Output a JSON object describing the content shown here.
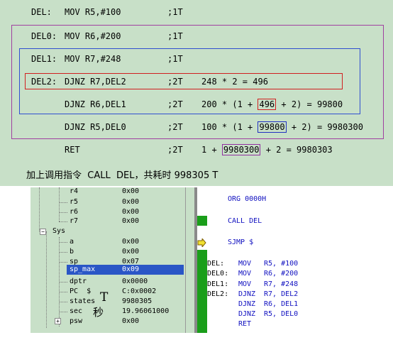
{
  "code": {
    "lines": [
      {
        "label": "DEL:",
        "instr": "MOV R5,#100",
        "cycles": ";1T",
        "pre": "",
        "box": "",
        "post": ""
      },
      {
        "label": "DEL0:",
        "instr": "MOV R6,#200",
        "cycles": ";1T",
        "pre": "",
        "box": "",
        "post": ""
      },
      {
        "label": "DEL1:",
        "instr": "MOV R7,#248",
        "cycles": ";1T",
        "pre": "",
        "box": "",
        "post": ""
      },
      {
        "label": "DEL2:",
        "instr": "DJNZ R7,DEL2",
        "cycles": ";2T",
        "pre": "248 * 2 = 496",
        "box": "",
        "post": ""
      },
      {
        "label": "",
        "instr": "DJNZ R6,DEL1",
        "cycles": ";2T",
        "pre": "200 * (1 + ",
        "box": "496",
        "post": " + 2) = 99800"
      },
      {
        "label": "",
        "instr": "DJNZ R5,DEL0",
        "cycles": ";2T",
        "pre": "100 * (1 + ",
        "box": "99800",
        "post": " + 2) = 9980300"
      },
      {
        "label": "",
        "instr": "RET",
        "cycles": ";2T",
        "pre": "1 + ",
        "box": "9980300",
        "post": " + 2 = 9980303"
      }
    ],
    "summary": "加上调用指令  CALL  DEL，共耗时 998305 T",
    "colors": {
      "outer_box": "#a040a0",
      "inner_box": "#3050d0",
      "highlight": "#d02020",
      "value_box_1": "#d02020",
      "value_box_2": "#2030c0",
      "value_box_3": "#9030a0"
    }
  },
  "registers": {
    "rows": [
      {
        "name": "r4",
        "value": "0x00"
      },
      {
        "name": "r5",
        "value": "0x00"
      },
      {
        "name": "r6",
        "value": "0x00"
      },
      {
        "name": "r7",
        "value": "0x00"
      },
      {
        "name": "Sys",
        "value": ""
      },
      {
        "name": "a",
        "value": "0x00"
      },
      {
        "name": "b",
        "value": "0x00"
      },
      {
        "name": "sp",
        "value": "0x07"
      },
      {
        "name": "sp_max",
        "value": "0x09"
      },
      {
        "name": "dptr",
        "value": "0x0000"
      },
      {
        "name": "PC  $",
        "value": "C:0x0002"
      },
      {
        "name": "states",
        "value": "9980305"
      },
      {
        "name": "sec",
        "value": "19.96061000"
      },
      {
        "name": "psw",
        "value": "0x00"
      }
    ],
    "selected": "sp_max",
    "annotations": {
      "states_mark": "T",
      "sec_mark": "秒"
    },
    "expand_sys": "−",
    "expand_psw": "+"
  },
  "disassembly": {
    "lines": [
      {
        "label": "",
        "op": "ORG",
        "args": "0000H"
      },
      {
        "label": "",
        "op": "CALL",
        "args": "DEL"
      },
      {
        "label": "",
        "op": "SJMP",
        "args": "$"
      },
      {
        "label": "DEL:",
        "op": "MOV",
        "args": "R5, #100"
      },
      {
        "label": "DEL0:",
        "op": "MOV",
        "args": "R6, #200"
      },
      {
        "label": "DEL1:",
        "op": "MOV",
        "args": "R7, #248"
      },
      {
        "label": "DEL2:",
        "op": "DJNZ",
        "args": "R7, DEL2"
      },
      {
        "label": "",
        "op": "DJNZ",
        "args": "R6, DEL1"
      },
      {
        "label": "",
        "op": "DJNZ",
        "args": "R5, DEL0"
      },
      {
        "label": "",
        "op": "RET",
        "args": ""
      }
    ],
    "current_line_icon": "yellow-arrow-icon"
  }
}
